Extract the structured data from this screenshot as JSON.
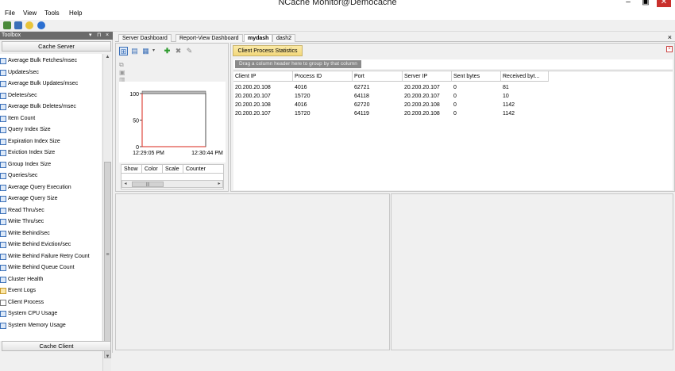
{
  "window": {
    "title": "NCache Monitor@Democache",
    "controls": [
      "–",
      "▣",
      "✕"
    ]
  },
  "menu": {
    "items": [
      "File",
      "View",
      "Tools",
      "Help"
    ]
  },
  "toolbox": {
    "title": "Toolbox",
    "header_controls": [
      "▾",
      "⊓",
      "×"
    ],
    "cache_server_label": "Cache Server",
    "cache_client_label": "Cache Client",
    "items": [
      "Average Bulk Fetches/msec",
      "Updates/sec",
      "Average Bulk Updates/msec",
      "Deletes/sec",
      "Average Bulk Deletes/msec",
      "Item Count",
      "Query Index Size",
      "Expiration Index Size",
      "Eviction Index Size",
      "Group Index Size",
      "Queries/sec",
      "Average Query Execution",
      "Average Query Size",
      "Read Thru/sec",
      "Write Thru/sec",
      "Write Behind/sec",
      "Write Behind Eviction/sec",
      "Write Behind Failure Retry Count",
      "Write Behind Queue Count",
      "Cluster Health",
      "Event Logs",
      "Client Process",
      "System CPU Usage",
      "System Memory Usage"
    ]
  },
  "tabs": {
    "items": [
      "Server Dashboard",
      "Report-View Dashboard",
      "mydash",
      "dash2"
    ],
    "active_index": 2,
    "close_glyph": "×"
  },
  "chart_panel": {
    "legend_columns": [
      "Show",
      "Color",
      "Scale",
      "Counter"
    ],
    "scroll_glyph": "|||"
  },
  "chart_data": {
    "type": "line",
    "ylim": [
      0,
      100
    ],
    "y_ticks": [
      "100",
      "50",
      "0"
    ],
    "x_ticks": [
      "12:29:05 PM",
      "12:30:44 PM"
    ],
    "series": [
      {
        "color": "#d9241a",
        "x": [
          0,
          0,
          1
        ],
        "values": [
          100,
          0,
          0
        ]
      }
    ],
    "grid": false
  },
  "client_stats": {
    "tab_label": "Client Process Statistics",
    "group_hint": "Drag a column header here to group by that column",
    "columns": [
      "Client IP",
      "Process ID",
      "Port",
      "Server IP",
      "Sent bytes",
      "Received byt..."
    ],
    "rows": [
      [
        "20.200.20.108",
        "4016",
        "62721",
        "20.200.20.107",
        "0",
        "81"
      ],
      [
        "20.200.20.107",
        "15720",
        "64118",
        "20.200.20.107",
        "0",
        "10"
      ],
      [
        "20.200.20.108",
        "4016",
        "62720",
        "20.200.20.108",
        "0",
        "1142"
      ],
      [
        "20.200.20.107",
        "15720",
        "64119",
        "20.200.20.108",
        "0",
        "1142"
      ]
    ]
  },
  "colors": {
    "accent": "#f2d77b",
    "toolbox_header": "#6b6b6b",
    "series": "#d9241a"
  }
}
